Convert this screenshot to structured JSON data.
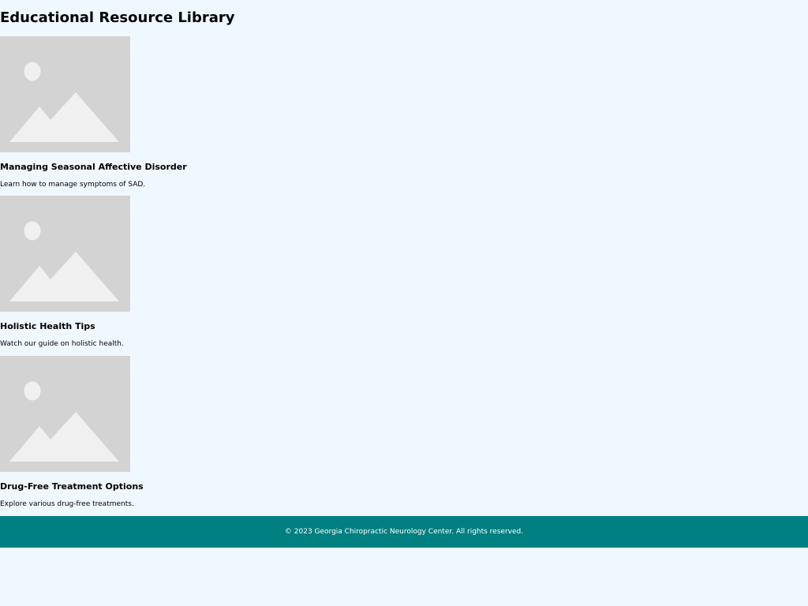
{
  "page": {
    "title": "Educational Resource Library"
  },
  "resources": [
    {
      "title": "Managing Seasonal Affective Disorder",
      "description": "Learn how to manage symptoms of SAD.",
      "thumbnail_icon": "image-placeholder-icon"
    },
    {
      "title": "Holistic Health Tips",
      "description": "Watch our guide on holistic health.",
      "thumbnail_icon": "image-placeholder-icon"
    },
    {
      "title": "Drug-Free Treatment Options",
      "description": "Explore various drug-free treatments.",
      "thumbnail_icon": "image-placeholder-icon"
    }
  ],
  "footer": {
    "text": "© 2023 Georgia Chiropractic Neurology Center. All rights reserved."
  },
  "colors": {
    "background": "#f0f8ff",
    "footer_background": "#008080",
    "footer_text": "#ffffff",
    "placeholder": "#d3d3d3",
    "placeholder_shape": "#f0f0f0"
  }
}
